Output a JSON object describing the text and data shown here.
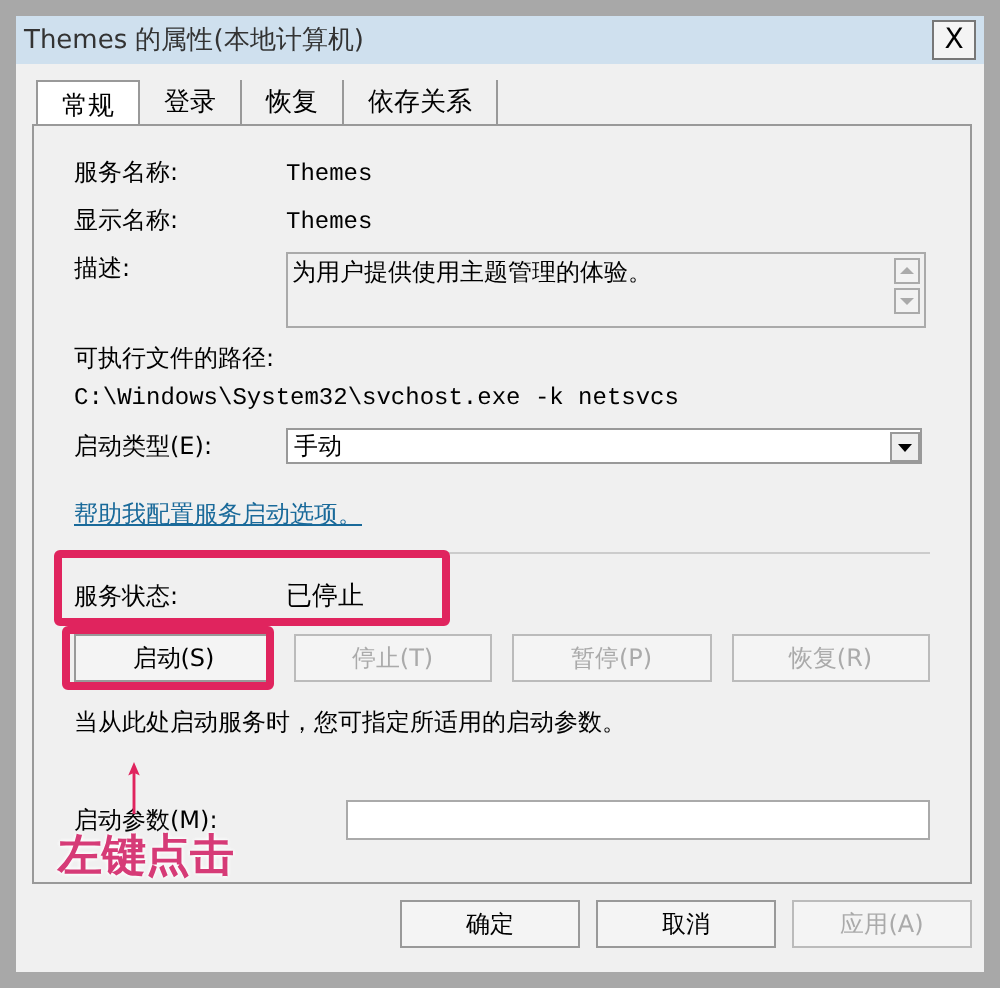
{
  "window": {
    "title": "Themes 的属性(本地计算机)",
    "close": "X"
  },
  "tabs": [
    {
      "label": "常规",
      "selected": true
    },
    {
      "label": "登录",
      "selected": false
    },
    {
      "label": "恢复",
      "selected": false
    },
    {
      "label": "依存关系",
      "selected": false
    }
  ],
  "info": [
    {
      "label": "服务名称:",
      "value": "Themes"
    },
    {
      "label": "显示名称:",
      "value": "Themes"
    }
  ],
  "description": {
    "label": "描述:",
    "value": "为用户提供使用主题管理的体验。"
  },
  "path": {
    "label": "可执行文件的路径:",
    "value": "C:\\Windows\\System32\\svchost.exe -k netsvcs"
  },
  "startup_type": {
    "label": "启动类型(E):",
    "value": "手动"
  },
  "help_link": "帮助我配置服务启动选项。",
  "status": {
    "label": "服务状态:",
    "value": "已停止"
  },
  "service_buttons": [
    {
      "label": "启动(S)",
      "disabled": false
    },
    {
      "label": "停止(T)",
      "disabled": true
    },
    {
      "label": "暂停(P)",
      "disabled": true
    },
    {
      "label": "恢复(R)",
      "disabled": true
    }
  ],
  "hint": "当从此处启动服务时，您可指定所适用的启动参数。",
  "parameters": {
    "label": "启动参数(M):"
  },
  "annotation": {
    "text": "左键点击"
  },
  "dialog_buttons": [
    {
      "label": "确定",
      "disabled": false
    },
    {
      "label": "取消",
      "disabled": false
    },
    {
      "label": "应用(A)",
      "disabled": true
    }
  ]
}
